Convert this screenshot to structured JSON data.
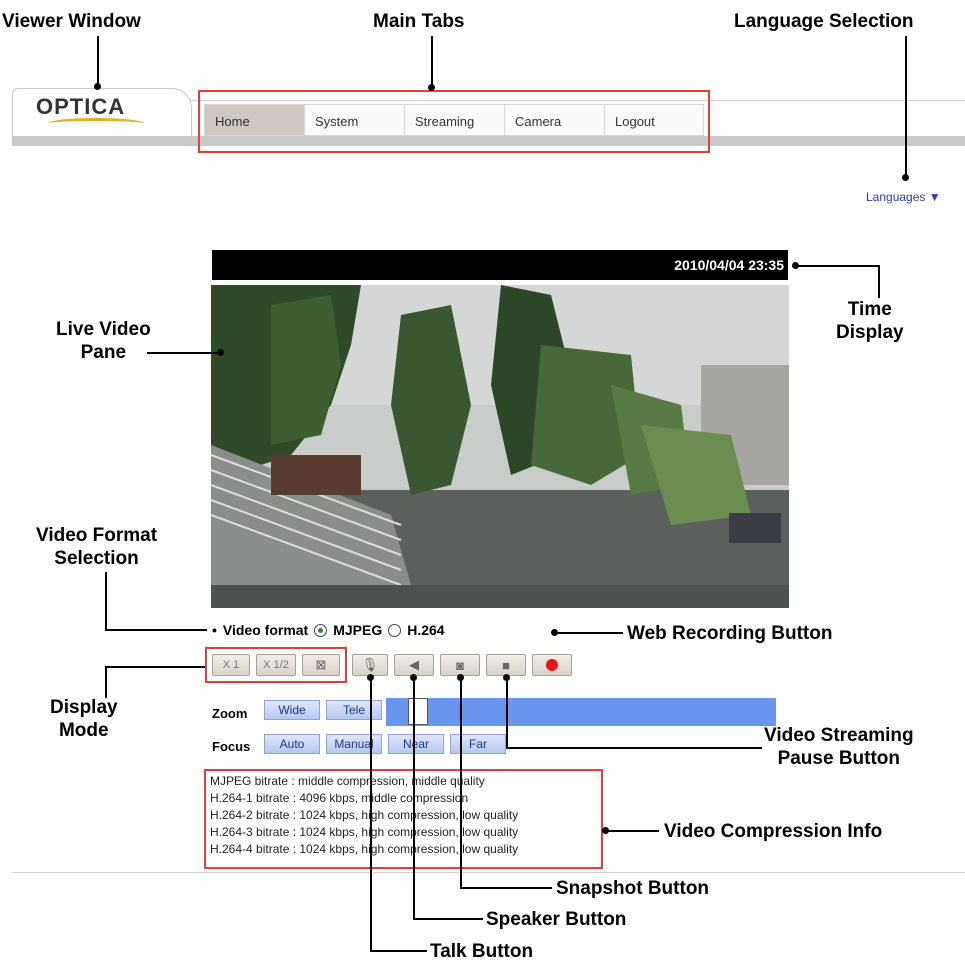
{
  "callouts": {
    "viewer_window": "Viewer Window",
    "main_tabs": "Main Tabs",
    "language_selection": "Language Selection",
    "time_display": "Time\nDisplay",
    "live_video_pane": "Live Video\nPane",
    "video_format_selection": "Video Format\nSelection",
    "web_recording_button": "Web Recording Button",
    "display_mode": "Display\nMode",
    "video_streaming_pause_button": "Video Streaming\nPause Button",
    "video_compression_info": "Video Compression Info",
    "snapshot_button": "Snapshot Button",
    "speaker_button": "Speaker Button",
    "talk_button": "Talk Button"
  },
  "app": {
    "logo": "OPTICA",
    "tabs": [
      "Home",
      "System",
      "Streaming",
      "Camera",
      "Logout"
    ],
    "active_tab": "Home",
    "languages": "Languages ▼",
    "timestamp": "2010/04/04 23:35"
  },
  "video_format": {
    "label": "Video format",
    "options": [
      "MJPEG",
      "H.264"
    ],
    "selected": "MJPEG"
  },
  "display_mode": {
    "x1": "X 1",
    "x_half": "X 1/2",
    "fullscreen_icon": "fullscreen-icon"
  },
  "controls": {
    "talk_icon": "microphone-icon",
    "speaker_icon": "speaker-icon",
    "snapshot_icon": "camera-icon",
    "pause_icon": "stop-icon",
    "record_icon": "record-icon",
    "record_color": "#e8141a"
  },
  "zoom": {
    "label": "Zoom",
    "wide": "Wide",
    "tele": "Tele",
    "level": 0.06
  },
  "focus": {
    "label": "Focus",
    "auto": "Auto",
    "manual": "Manual",
    "near": "Near",
    "far": "Far"
  },
  "compression_info": [
    "MJPEG bitrate : middle compression, middle quality",
    "H.264-1 bitrate : 4096 kbps, middle compression",
    "H.264-2 bitrate : 1024 kbps, high compression, low quality",
    "H.264-3 bitrate : 1024 kbps, high compression, low quality",
    "H.264-4 bitrate : 1024 kbps, high compression, low quality"
  ],
  "colors": {
    "zoom_bar": "#6a95ee",
    "annotation_box": "#e53c3c",
    "tab_active": "#cfc8c0"
  }
}
